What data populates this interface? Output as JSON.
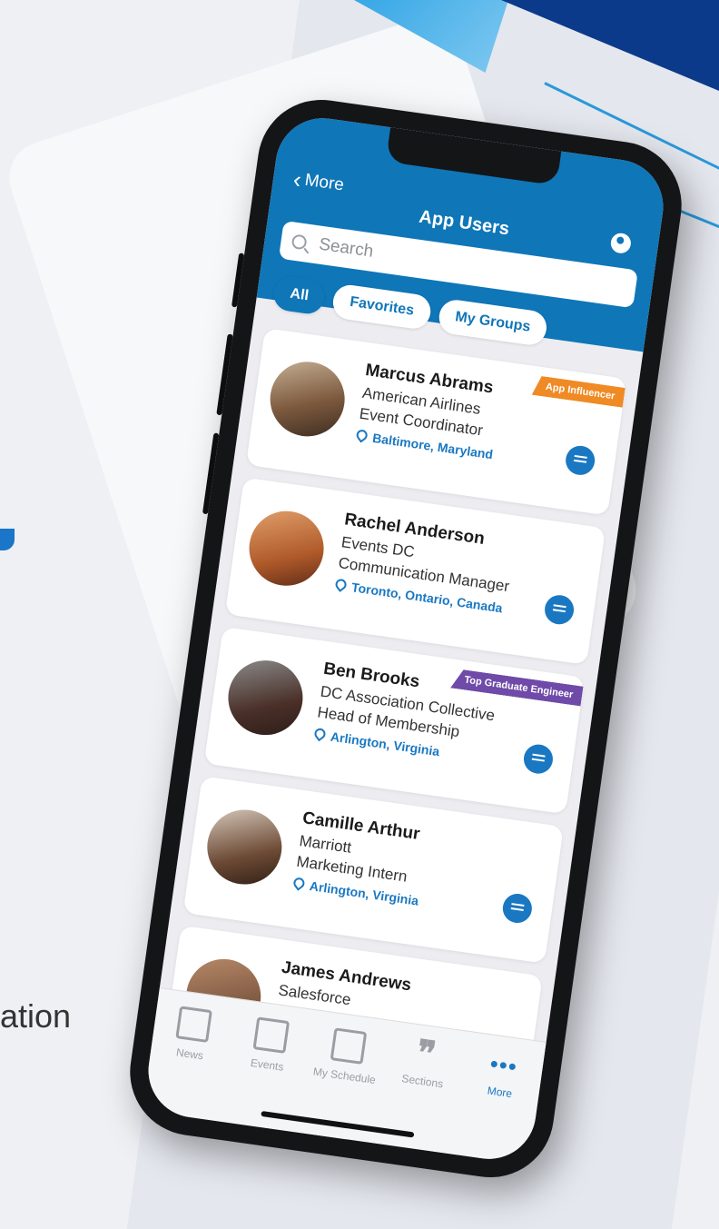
{
  "background": {
    "tagline_fragment": "ation"
  },
  "header": {
    "back_label": "More",
    "title": "App Users",
    "search_placeholder": "Search"
  },
  "filters": [
    {
      "label": "All",
      "active": true
    },
    {
      "label": "Favorites",
      "active": false
    },
    {
      "label": "My Groups",
      "active": false
    }
  ],
  "users": [
    {
      "name": "Marcus Abrams",
      "company": "American Airlines",
      "role": "Event Coordinator",
      "location": "Baltimore, Maryland",
      "badge": "App Influencer",
      "badge_color": "#f08a24"
    },
    {
      "name": "Rachel Anderson",
      "company": "Events DC",
      "role": "Communication Manager",
      "location": "Toronto, Ontario, Canada",
      "badge": "",
      "badge_color": ""
    },
    {
      "name": "Ben Brooks",
      "company": "DC Association Collective",
      "role": "Head of Membership",
      "location": "Arlington, Virginia",
      "badge": "Top Graduate Engineer",
      "badge_color": "#6f4aa8"
    },
    {
      "name": "Camille Arthur",
      "company": "Marriott",
      "role": "Marketing Intern",
      "location": "Arlington, Virginia",
      "badge": "",
      "badge_color": ""
    },
    {
      "name": "James Andrews",
      "company": "Salesforce",
      "role": "",
      "location": "",
      "badge": "",
      "badge_color": ""
    }
  ],
  "tabbar": [
    {
      "label": "News",
      "icon": "newspaper-icon",
      "active": false
    },
    {
      "label": "Events",
      "icon": "calendar-icon",
      "active": false
    },
    {
      "label": "My Schedule",
      "icon": "calendar-check-icon",
      "active": false
    },
    {
      "label": "Sections",
      "icon": "quote-icon",
      "active": false
    },
    {
      "label": "More",
      "icon": "more-dots-icon",
      "active": true
    }
  ],
  "colors": {
    "primary": "#0f76b8",
    "link": "#1a78c2"
  }
}
